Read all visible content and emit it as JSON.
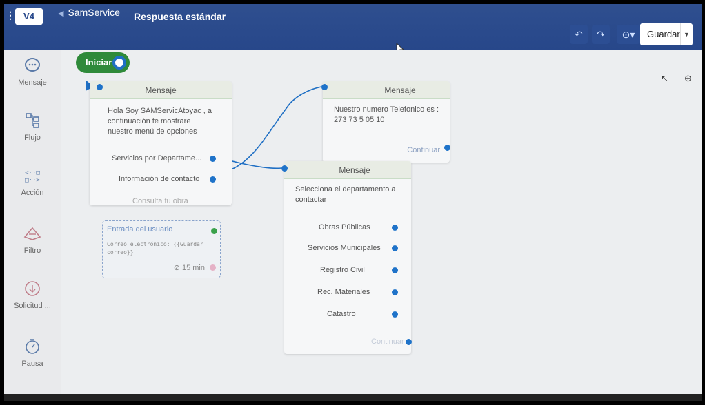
{
  "header": {
    "app_name": "SamService",
    "flow_name": "Respuesta estándar",
    "save_label": "Guardar",
    "logo_text": "V4"
  },
  "sidebar": {
    "items": [
      {
        "label": "Mensaje",
        "icon": "chat-bubble-icon"
      },
      {
        "label": "Flujo",
        "icon": "flow-icon"
      },
      {
        "label": "Acción",
        "icon": "code-icon"
      },
      {
        "label": "Filtro",
        "icon": "filter-icon"
      },
      {
        "label": "Solicitud ...",
        "icon": "request-icon"
      },
      {
        "label": "Pausa",
        "icon": "timer-icon"
      }
    ]
  },
  "start": {
    "label": "Iniciar"
  },
  "card1": {
    "title": "Mensaje",
    "text": "Hola Soy SAMServicAtoyac , a continuación te mostrare nuestro menú de opciones",
    "options": [
      "Servicios por Departame...",
      "Información de contacto",
      "Consulta tu obra"
    ]
  },
  "user_input": {
    "title": "Entrada del usuario",
    "detail": "Correo electrónico: {{Guardar correo}}",
    "timeout": "15 min"
  },
  "card2": {
    "title": "Mensaje",
    "text": "Nuestro numero Telefonico es : 273 73 5 05 10",
    "continue_label": "Continuar"
  },
  "card3": {
    "title": "Mensaje",
    "text": "Selecciona el departamento a contactar",
    "options": [
      "Obras Públicas",
      "Servicios Municipales",
      "Registro Civil",
      "Rec. Materiales",
      "Catastro"
    ],
    "continue_label": "Continuar"
  },
  "colors": {
    "topbar": "#2f4f8f",
    "accent": "#1f73c9",
    "start": "#2f8a3a"
  }
}
